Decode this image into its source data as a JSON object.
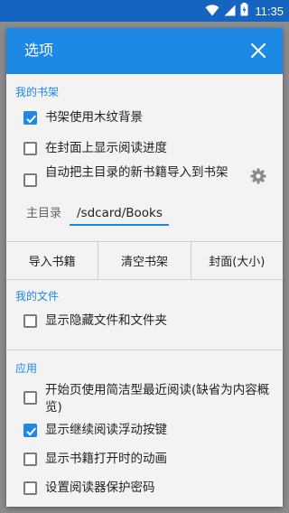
{
  "status_bar": {
    "time": "11:35",
    "icons": [
      "wifi-icon",
      "signal-icon",
      "battery-charging-icon"
    ]
  },
  "dialog": {
    "title": "选项",
    "close_icon": "close-icon"
  },
  "sections": {
    "shelf": {
      "title": "我的书架",
      "options": [
        {
          "label": "书架使用木纹背景",
          "checked": true
        },
        {
          "label": "在封面上显示阅读进度",
          "checked": false
        },
        {
          "label": "自动把主目录的新书籍导入到书架",
          "checked": false
        }
      ],
      "settings_icon": "gear-icon",
      "home_dir_label": "主目录",
      "home_dir_value": "/sdcard/Books",
      "buttons": [
        "导入书籍",
        "清空书架",
        "封面(大小)"
      ]
    },
    "files": {
      "title": "我的文件",
      "options": [
        {
          "label": "显示隐藏文件和文件夹",
          "checked": false
        }
      ]
    },
    "app": {
      "title": "应用",
      "options": [
        {
          "label": "开始页使用简洁型最近阅读(缺省为内容概览)",
          "checked": false
        },
        {
          "label": "显示继续阅读浮动按键",
          "checked": true
        },
        {
          "label": "显示书籍打开时的动画",
          "checked": false
        },
        {
          "label": "设置阅读器保护密码",
          "checked": false
        }
      ]
    }
  },
  "colors": {
    "accent": "#1e88e5",
    "statusbar": "#1565c0"
  }
}
